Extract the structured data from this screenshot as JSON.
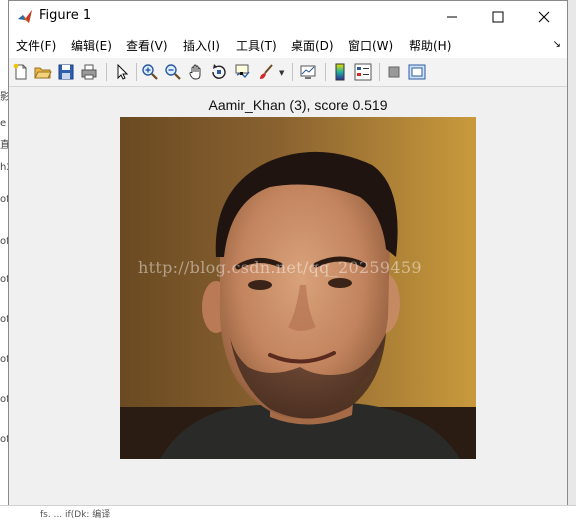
{
  "window": {
    "title": "Figure 1"
  },
  "menu": {
    "items": [
      {
        "label": "文件(F)"
      },
      {
        "label": "编辑(E)"
      },
      {
        "label": "查看(V)"
      },
      {
        "label": "插入(I)"
      },
      {
        "label": "工具(T)"
      },
      {
        "label": "桌面(D)"
      },
      {
        "label": "窗口(W)"
      },
      {
        "label": "帮助(H)"
      }
    ],
    "overflow_arrow": "↘"
  },
  "toolbar": {
    "icons": [
      "new-figure-icon",
      "open-file-icon",
      "save-icon",
      "print-icon",
      "edit-plot-arrow-icon",
      "zoom-in-icon",
      "zoom-out-icon",
      "pan-hand-icon",
      "rotate-3d-icon",
      "data-cursor-icon",
      "brush-icon",
      "link-plot-icon",
      "insert-colorbar-icon",
      "insert-legend-icon",
      "hide-plot-tools-icon",
      "show-plot-tools-icon"
    ]
  },
  "figure": {
    "title": "Aamir_Khan (3), score 0.519",
    "watermark": "http://blog.csdn.net/qq_20259459"
  },
  "background": {
    "left_fragments": [
      "影",
      "e",
      "直",
      "h2",
      "of",
      "of",
      "of",
      "of",
      "of",
      "of",
      "of"
    ],
    "bottom_text": "fs.  ...  if(Dk: 编译"
  }
}
